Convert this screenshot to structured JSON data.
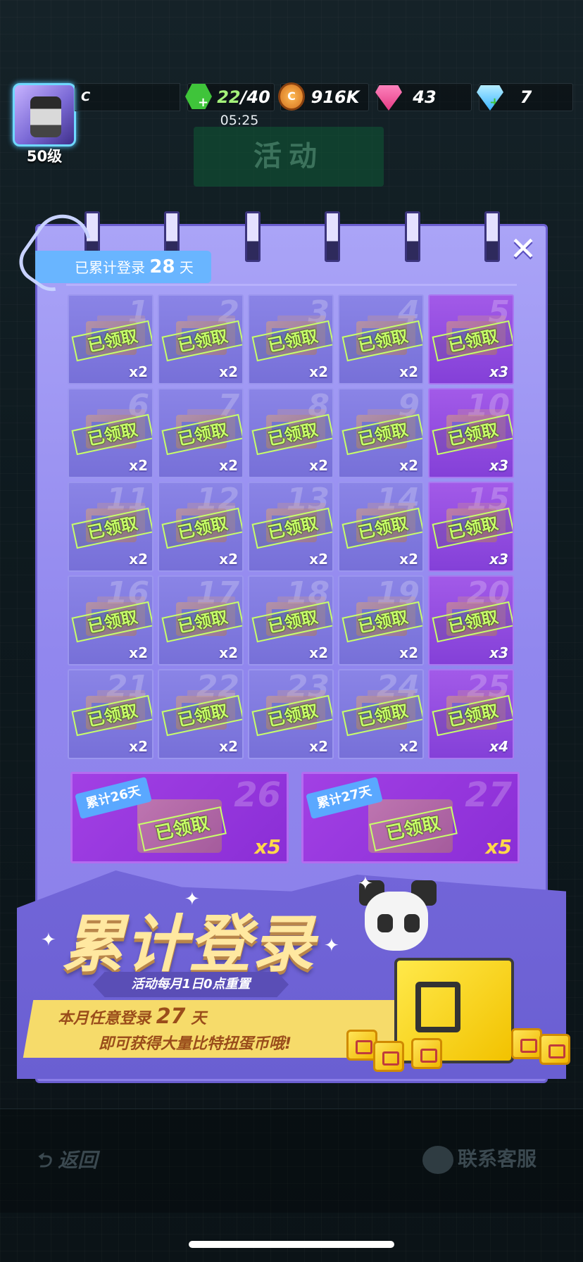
{
  "player": {
    "name": "C",
    "level_label": "50级"
  },
  "resources": {
    "energy_current": "22",
    "energy_max": "/40",
    "energy_timer": "05:25",
    "coins": "916K",
    "coin_icon_letter": "C",
    "pink_gems": "43",
    "diamonds": "7"
  },
  "header": {
    "title": "活动"
  },
  "panel": {
    "login_prefix": "已累计登录",
    "login_days": "28",
    "login_suffix": "天",
    "close_label": "✕",
    "claimed_label": "已领取",
    "days": [
      {
        "day": "1",
        "qty": "x2"
      },
      {
        "day": "2",
        "qty": "x2"
      },
      {
        "day": "3",
        "qty": "x2"
      },
      {
        "day": "4",
        "qty": "x2"
      },
      {
        "day": "5",
        "qty": "x3"
      },
      {
        "day": "6",
        "qty": "x2"
      },
      {
        "day": "7",
        "qty": "x2"
      },
      {
        "day": "8",
        "qty": "x2"
      },
      {
        "day": "9",
        "qty": "x2"
      },
      {
        "day": "10",
        "qty": "x3"
      },
      {
        "day": "11",
        "qty": "x2"
      },
      {
        "day": "12",
        "qty": "x2"
      },
      {
        "day": "13",
        "qty": "x2"
      },
      {
        "day": "14",
        "qty": "x2"
      },
      {
        "day": "15",
        "qty": "x3"
      },
      {
        "day": "16",
        "qty": "x2"
      },
      {
        "day": "17",
        "qty": "x2"
      },
      {
        "day": "18",
        "qty": "x2"
      },
      {
        "day": "19",
        "qty": "x2"
      },
      {
        "day": "20",
        "qty": "x3"
      },
      {
        "day": "21",
        "qty": "x2"
      },
      {
        "day": "22",
        "qty": "x2"
      },
      {
        "day": "23",
        "qty": "x2"
      },
      {
        "day": "24",
        "qty": "x2"
      },
      {
        "day": "25",
        "qty": "x4"
      }
    ],
    "milestones": [
      {
        "day": "26",
        "ribbon": "累计26天",
        "qty": "x5"
      },
      {
        "day": "27",
        "ribbon": "累计27天",
        "qty": "x5"
      }
    ]
  },
  "banner": {
    "title": "累计登录",
    "subtitle": "活动每月1日0点重置",
    "line1_prefix": "本月任意登录",
    "line1_days": "27",
    "line1_suffix": "天",
    "line2": "即可获得大量比特扭蛋币哦!"
  },
  "footer": {
    "back_label": "返回",
    "support_label": "联系客服"
  },
  "colors": {
    "panel_bg": "#9187ee",
    "claimed_stamp": "#c8ff6a",
    "special_cell": "#a25ae8",
    "title_gold": "#ffe8a0"
  }
}
